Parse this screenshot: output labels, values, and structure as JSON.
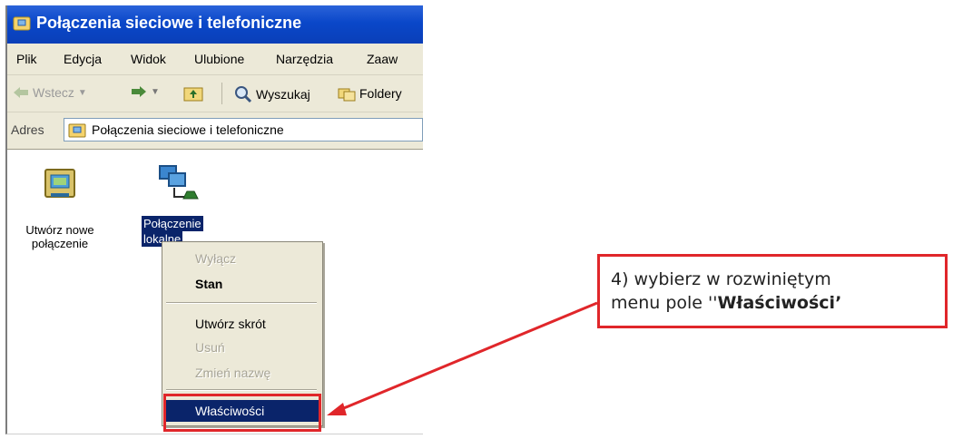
{
  "window": {
    "title": "Połączenia sieciowe i telefoniczne"
  },
  "menubar": {
    "items": [
      "Plik",
      "Edycja",
      "Widok",
      "Ulubione",
      "Narzędzia",
      "Zaaw"
    ]
  },
  "toolbar": {
    "back_label": "Wstecz",
    "search_label": "Wyszukaj",
    "folders_label": "Foldery"
  },
  "addressbar": {
    "label": "Adres",
    "value": "Połączenia sieciowe i telefoniczne"
  },
  "icons": {
    "new_connection_line1": "Utwórz nowe",
    "new_connection_line2": "połączenie",
    "local_connection_line1": "Połączenie",
    "local_connection_line2": "lokalne"
  },
  "context_menu": {
    "disable": "Wyłącz",
    "status": "Stan",
    "create_shortcut": "Utwórz skrót",
    "delete": "Usuń",
    "rename": "Zmień nazwę",
    "properties": "Właściwości"
  },
  "callout": {
    "line1": "4) wybierz w rozwiniętym",
    "line2_prefix": "menu pole ''",
    "line2_bold": "Właściwości",
    "line2_suffix": "’"
  },
  "colors": {
    "titlebar": "#0a47c9",
    "selection": "#0a246a",
    "highlight_red": "#e0262a",
    "menu_bg": "#ece9d8"
  }
}
